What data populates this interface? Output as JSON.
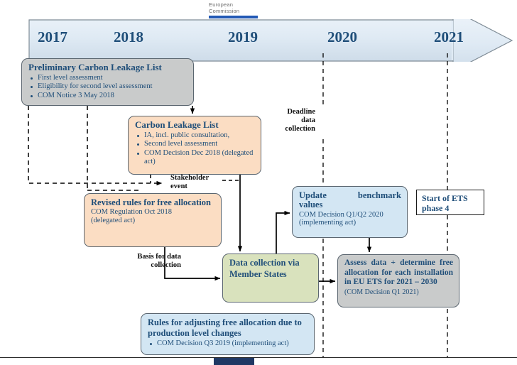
{
  "logo": {
    "line1": "European",
    "line2": "Commission",
    "bar_color": "#2359b5"
  },
  "timeline": {
    "name": "year-timeline-arrow",
    "years": [
      "2017",
      "2018",
      "2019",
      "2020",
      "2021"
    ],
    "fill_top": "#eef4fa",
    "fill_bottom": "#cddcea",
    "text_color": "#1f4e79"
  },
  "boxes": {
    "preliminary": {
      "title": "Preliminary Carbon Leakage List",
      "bullets": [
        "First level assessment",
        "Eligibility for second level assessment",
        "COM Notice 3 May 2018"
      ],
      "fill": "#c9cbcb"
    },
    "carbon_leakage_list": {
      "title": "Carbon Leakage List",
      "bullets": [
        "IA, incl. public consultation,",
        "Second level assessment",
        "COM Decision Dec 2018 (delegated act)"
      ],
      "fill": "#fbddc3"
    },
    "revised_rules": {
      "title": "Revised rules for free allocation",
      "sub1": "COM Regulation Oct 2018",
      "sub2": "(delegated act)",
      "fill": "#fbddc3"
    },
    "update_benchmark": {
      "title_line1": "Update   benchmark",
      "title_line2": "values",
      "sub1": "COM Decision Q1/Q2 2020",
      "sub2": "(implementing act)",
      "fill": "#d3e6f3"
    },
    "start_ets": {
      "title": "Start of ETS phase 4",
      "fill": "#ffffff"
    },
    "data_collection": {
      "title": "Data collection via Member States",
      "fill": "#d9e2bd"
    },
    "assess_data": {
      "title": "Assess data + determine free allocation for each installation in EU ETS for 2021 – 2030",
      "sub1": "(COM Decision Q1 2021)",
      "fill": "#c9cbcb"
    },
    "adjusting_rules": {
      "title": "Rules for adjusting free allocation due to production level changes",
      "bullets": [
        "COM Decision Q3 2019 (implementing act)"
      ],
      "fill": "#d3e6f3"
    }
  },
  "annotations": {
    "stakeholder_event": "Stakeholder event",
    "basis_for_data_collection": "Basis for data collection",
    "deadline_data_collection": "Deadline data collection"
  }
}
